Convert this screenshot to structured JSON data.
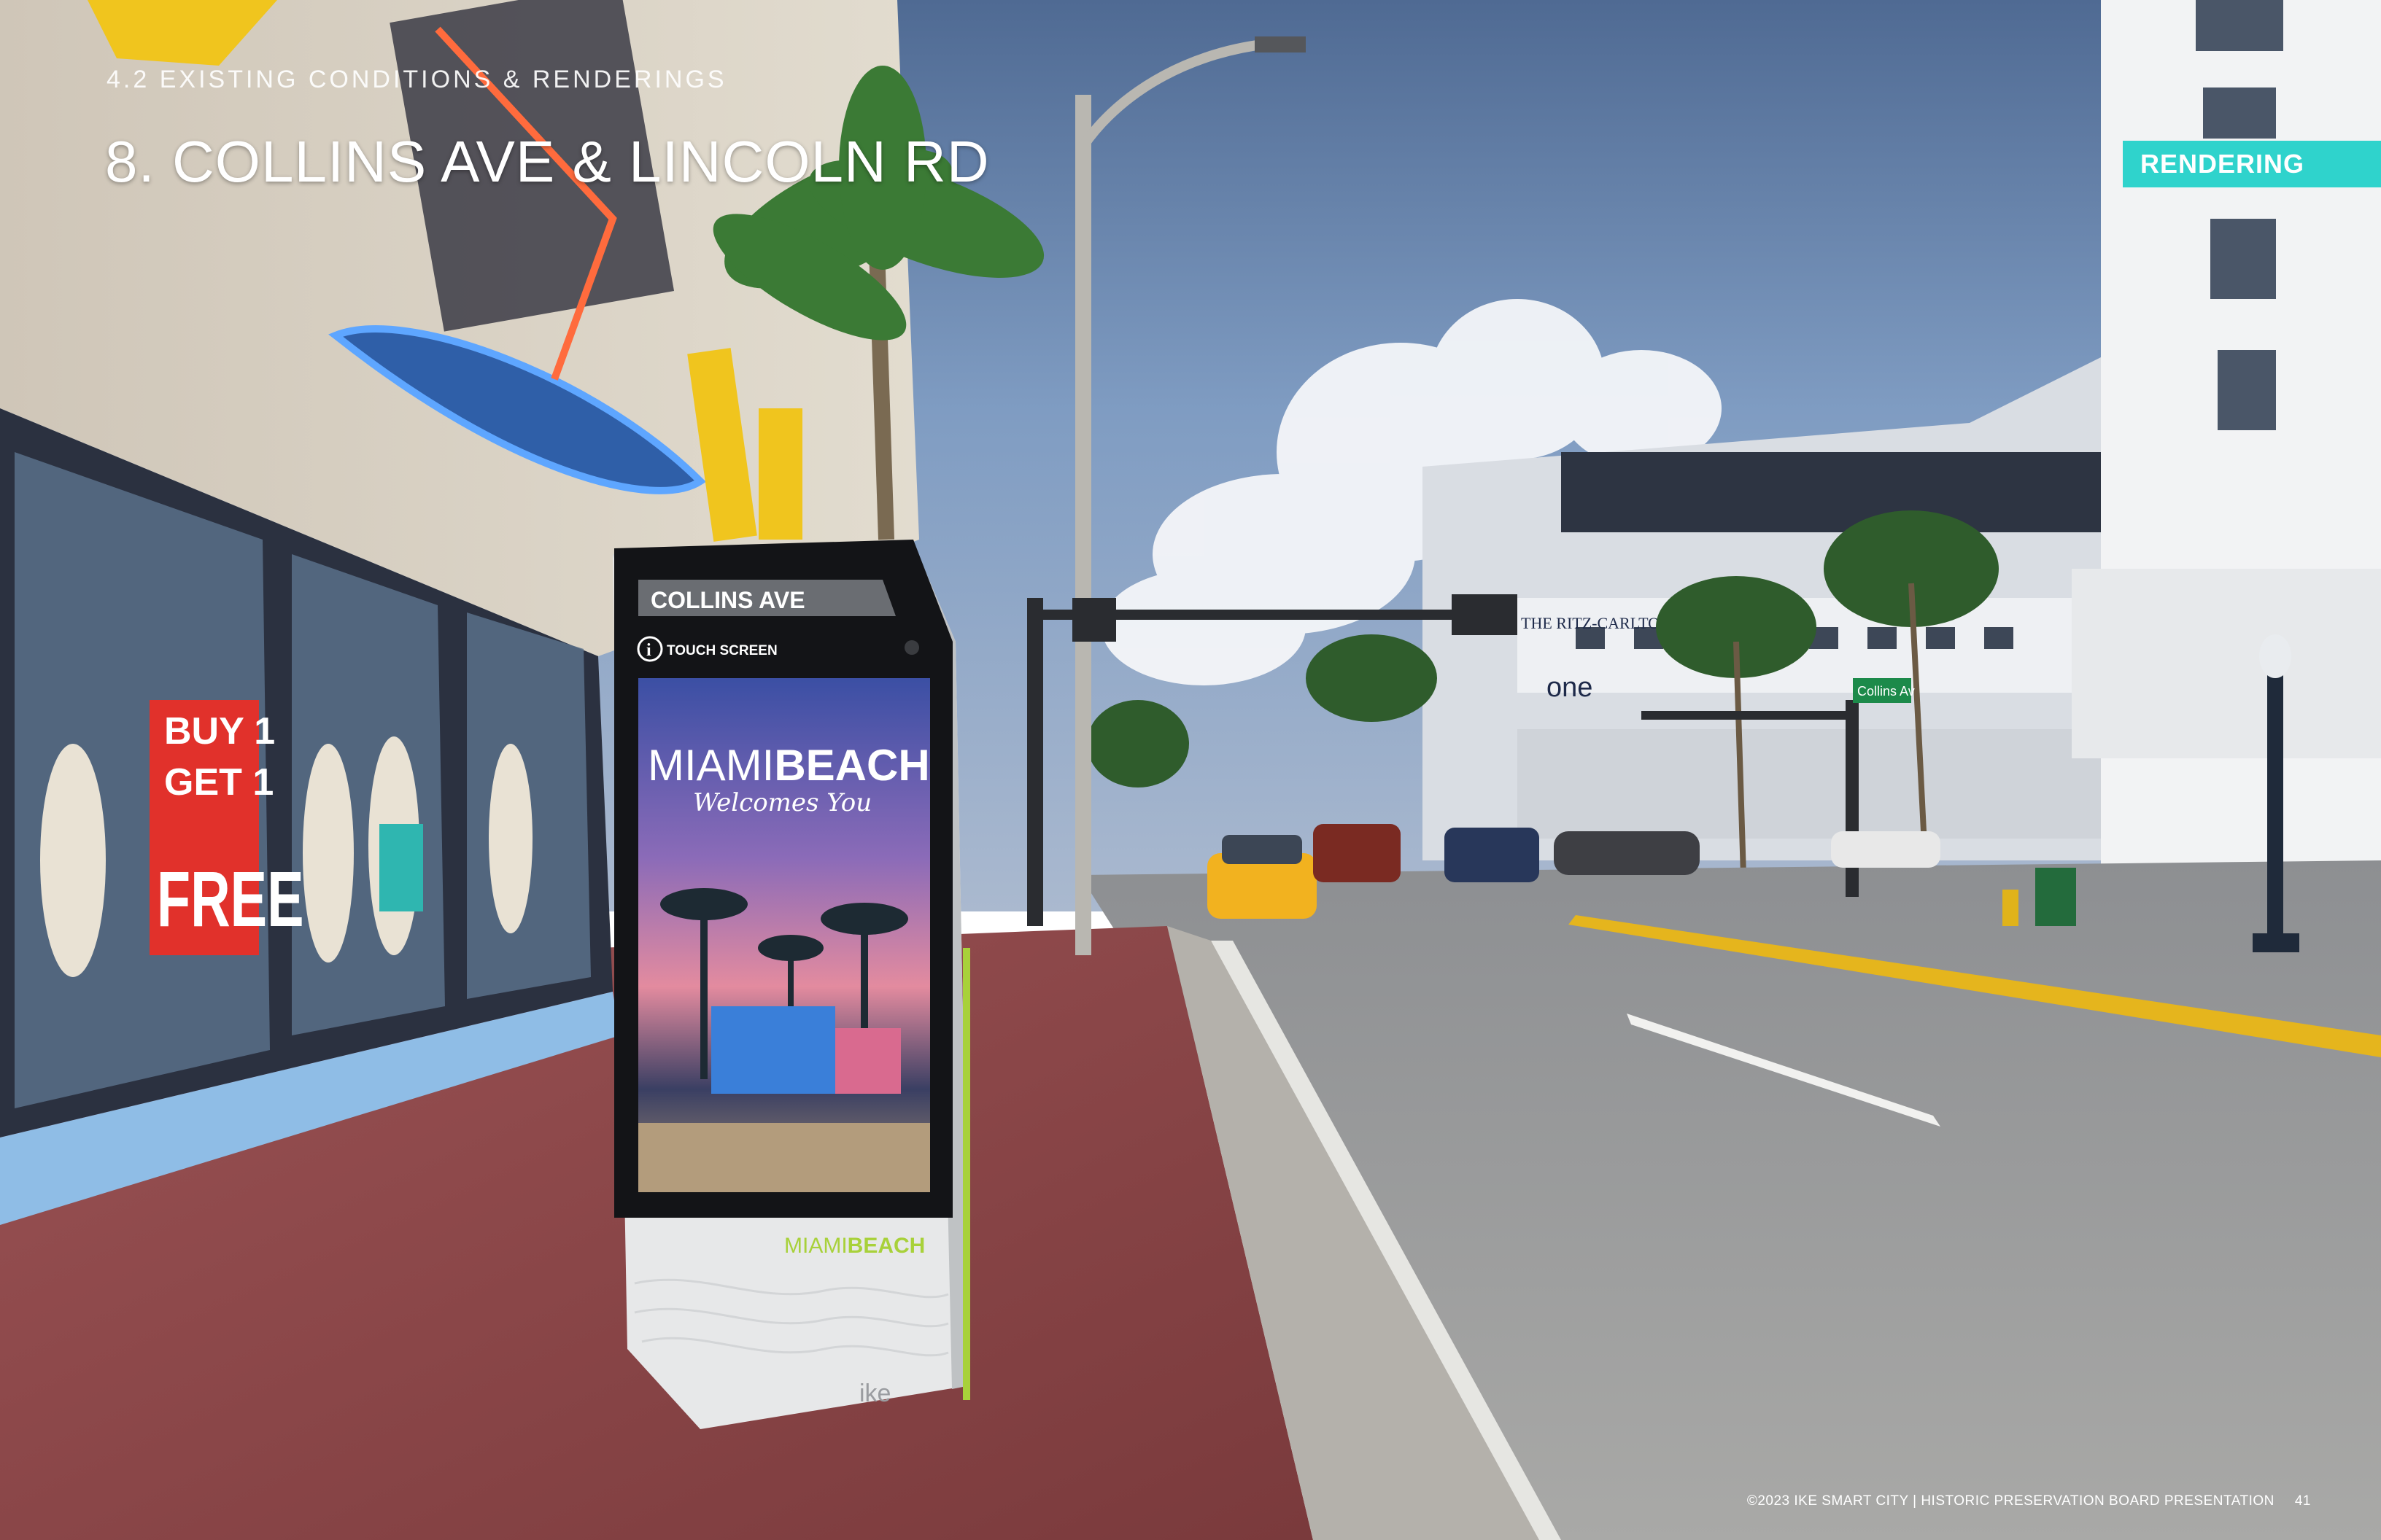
{
  "header": {
    "section_label": "4.2 EXISTING CONDITIONS & RENDERINGS",
    "title": "8. COLLINS AVE & LINCOLN RD"
  },
  "badge": {
    "label": "RENDERING",
    "color": "#2fd3cc"
  },
  "footer": {
    "text": "©2023 IKE SMART CITY | HISTORIC PRESERVATION BOARD PRESENTATION",
    "page_number": "41"
  },
  "kiosk": {
    "street_label": "COLLINS AVE",
    "touch_label": "TOUCH SCREEN",
    "screen_title_1": "MIAMI",
    "screen_title_2": "BEACH",
    "screen_subtitle": "Welcomes You",
    "base_logo_1": "MIAMI",
    "base_logo_2": "BEACH",
    "brand": "ike"
  },
  "scene_text": {
    "store_sign_line1": "BUY 1",
    "store_sign_line2": "GET 1",
    "store_sign_line3": "FREE",
    "street_sign": "Collins Av",
    "hotel_sign": "THE RITZ-CARLTON",
    "one_sign": "one"
  },
  "colors": {
    "accent": "#2fd3cc",
    "kiosk_lime": "#a8d13a",
    "road_yellow": "#f1c21b",
    "sky": "#5f7ea8"
  }
}
